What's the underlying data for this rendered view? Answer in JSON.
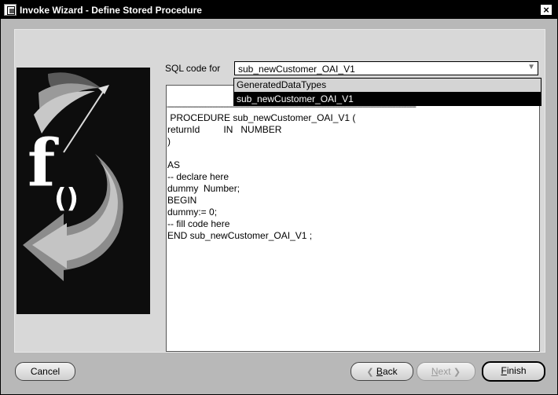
{
  "window": {
    "title": "Invoke Wizard - Define Stored Procedure",
    "close_glyph": "×"
  },
  "form": {
    "sql_label": "SQL code for",
    "combo": {
      "value": "sub_newCustomer_OAI_V1",
      "arrow": "▼"
    }
  },
  "dropdown": {
    "options": [
      "GeneratedDataTypes",
      "sub_newCustomer_OAI_V1"
    ],
    "highlighted_index": 0
  },
  "code": {
    "separator": "----------------------------------------------------------------------------------------------------------------------------------------",
    "lines": [
      " PROCEDURE sub_newCustomer_OAI_V1 (",
      "returnId         IN   NUMBER",
      ")",
      "",
      "AS",
      "-- declare here",
      "dummy  Number;",
      "BEGIN",
      "dummy:= 0;",
      "-- fill code here",
      "END sub_newCustomer_OAI_V1 ;"
    ]
  },
  "buttons": {
    "cancel": "Cancel",
    "back": {
      "arrow": "❮",
      "mnemonic": "B",
      "rest": "ack"
    },
    "next": {
      "mnemonic": "N",
      "rest": "ext",
      "arrow": "❯"
    },
    "finish": {
      "mnemonic": "F",
      "rest": "inish"
    }
  }
}
